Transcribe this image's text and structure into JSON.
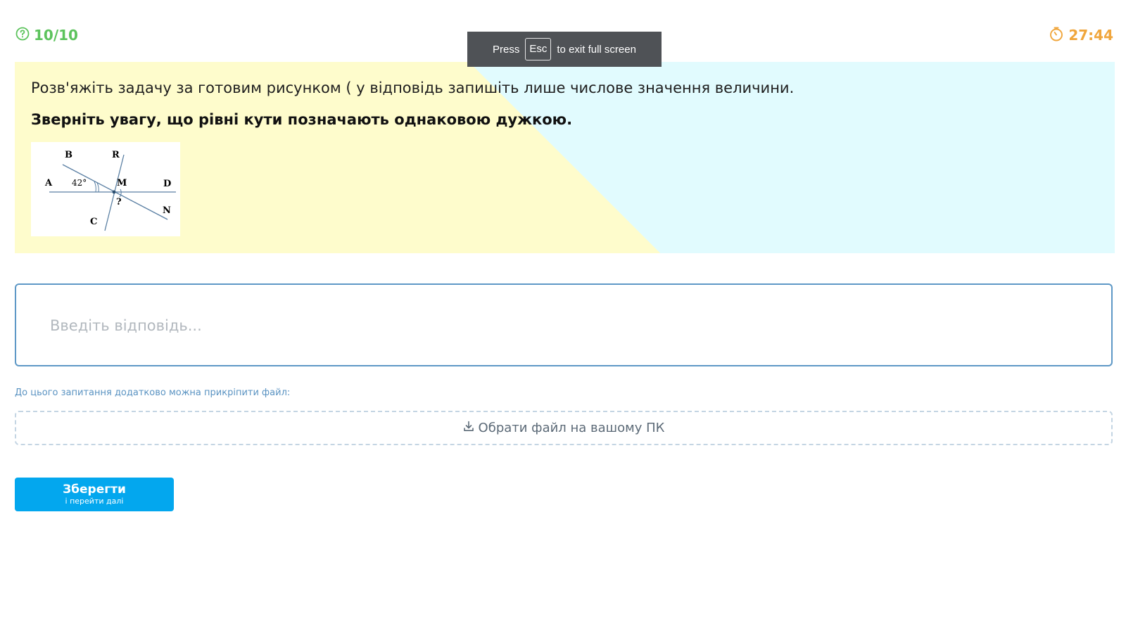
{
  "header": {
    "progress": "10/10",
    "progress_icon": "question-circle-icon",
    "timer": "27:44",
    "timer_icon": "stopwatch-icon",
    "progress_color": "#5cc35c",
    "timer_color": "#f0a63c"
  },
  "fullscreen_toast": {
    "press": "Press",
    "key": "Esc",
    "rest": "to exit full screen"
  },
  "question": {
    "text": "Розв'яжіть задачу за готовим рисунком ( у відповідь запишіть лише числове значення величини.",
    "note": "Зверніть увагу, що рівні кути позначають однаковою дужкою.",
    "figure": {
      "labels": {
        "B": "B",
        "R": "R",
        "A": "A",
        "angle": "42°",
        "M": "M",
        "D": "D",
        "question": "?",
        "N": "N",
        "C": "C"
      }
    }
  },
  "answer": {
    "placeholder": "Введіть відповідь...",
    "value": ""
  },
  "attachment": {
    "hint": "До цього запитання додатково можна прикріпити файл:",
    "button_label": "Обрати файл на вашому ПК",
    "icon": "download-icon"
  },
  "save_button": {
    "label": "Зберегти",
    "sublabel": "і перейти далі",
    "color": "#03a7ee"
  }
}
